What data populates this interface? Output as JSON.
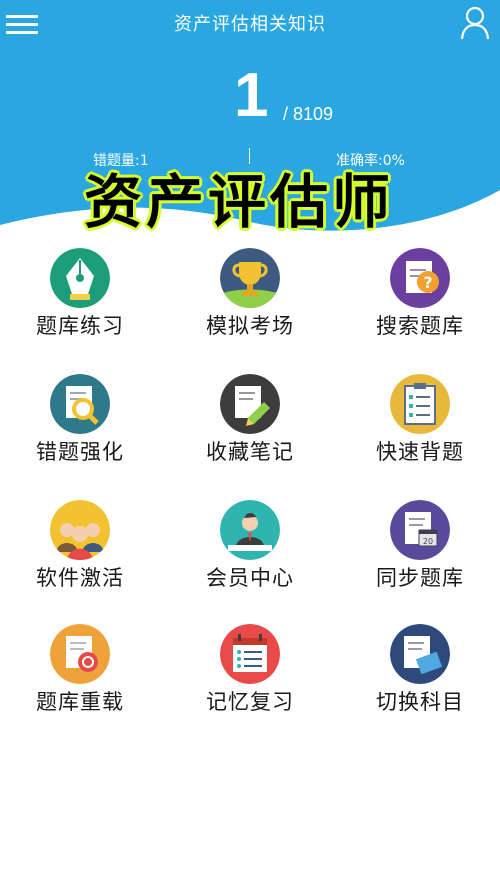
{
  "header": {
    "title": "资产评估相关知识",
    "current_index": "1",
    "total": "/ 8109",
    "wrong_count": "错题量:1",
    "accuracy": "准确率:0%",
    "colors": {
      "background": "#2aa7e0",
      "text": "#ffffff"
    }
  },
  "overlay": {
    "text": "资产评估师",
    "text_color": "#000000",
    "outline_color": "#d4ff2a"
  },
  "icons": {
    "menu": "hamburger-menu-icon",
    "user": "user-profile-icon"
  },
  "menu": [
    {
      "label": "题库练习",
      "icon": "fountain-pen-icon",
      "color": "#1d9e7a"
    },
    {
      "label": "模拟考场",
      "icon": "trophy-icon",
      "color": "#3d5a80"
    },
    {
      "label": "搜索题库",
      "icon": "question-document-icon",
      "color": "#6b3fa0"
    },
    {
      "label": "错题强化",
      "icon": "magnifier-document-icon",
      "color": "#2f7a8a"
    },
    {
      "label": "收藏笔记",
      "icon": "pen-note-icon",
      "color": "#3d3d3d"
    },
    {
      "label": "快速背题",
      "icon": "clipboard-icon",
      "color": "#e8b93a"
    },
    {
      "label": "软件激活",
      "icon": "group-people-icon",
      "color": "#f2c230"
    },
    {
      "label": "会员中心",
      "icon": "member-person-icon",
      "color": "#2fb5b0"
    },
    {
      "label": "同步题库",
      "icon": "calendar-document-icon",
      "color": "#5a4a9c"
    },
    {
      "label": "题库重载",
      "icon": "reload-document-icon",
      "color": "#f0a23a"
    },
    {
      "label": "记忆复习",
      "icon": "calendar-list-icon",
      "color": "#e84a4a"
    },
    {
      "label": "切换科目",
      "icon": "keyboard-document-icon",
      "color": "#2d4a7a"
    }
  ]
}
